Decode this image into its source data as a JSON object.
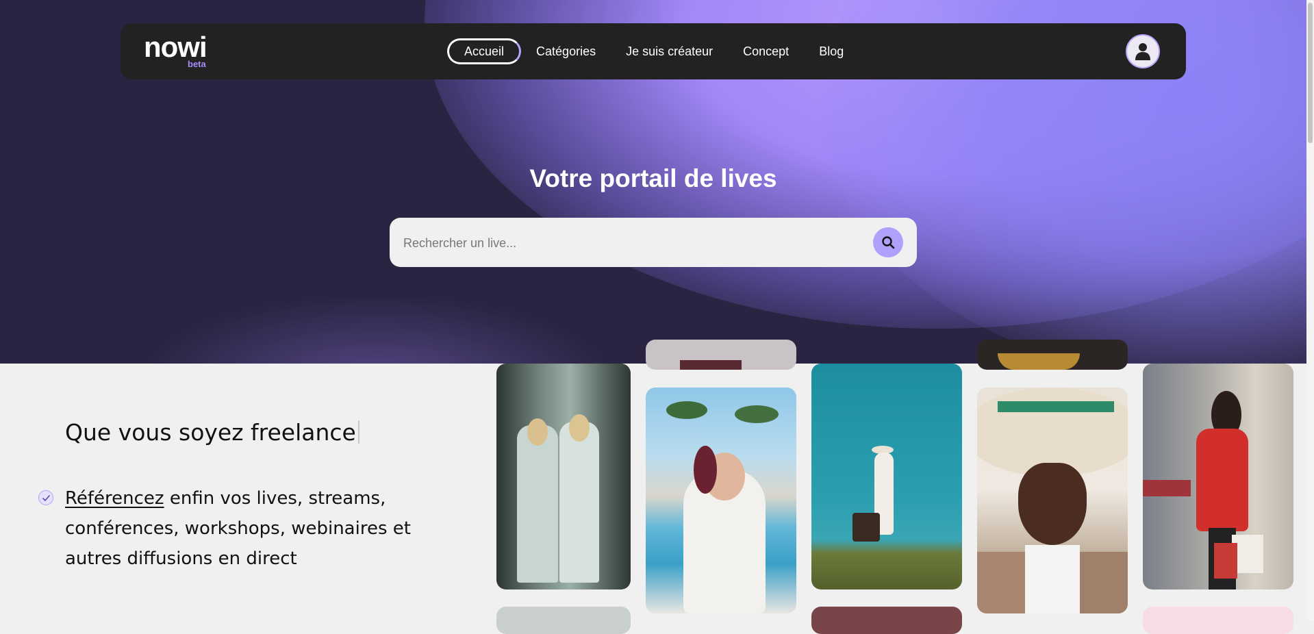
{
  "brand": {
    "name": "nowi",
    "tag": "beta"
  },
  "nav": {
    "items": [
      {
        "label": "Accueil",
        "active": true
      },
      {
        "label": "Catégories"
      },
      {
        "label": "Je suis créateur"
      },
      {
        "label": "Concept"
      },
      {
        "label": "Blog"
      }
    ]
  },
  "hero": {
    "title": "Votre portail de lives",
    "search_placeholder": "Rechercher un live..."
  },
  "content": {
    "tagline": "Que vous soyez freelance",
    "feature": {
      "link_text": "Référencez",
      "rest": " enfin vos lives, streams, conférences, workshops, webinaires et autres diffusions en direct"
    }
  },
  "colors": {
    "accent": "#a78bfa",
    "navbar": "#222222",
    "hero_dark": "#2a2442",
    "hero_light": "#b79bfb"
  },
  "icons": [
    "user-icon",
    "search-icon",
    "check-icon"
  ]
}
